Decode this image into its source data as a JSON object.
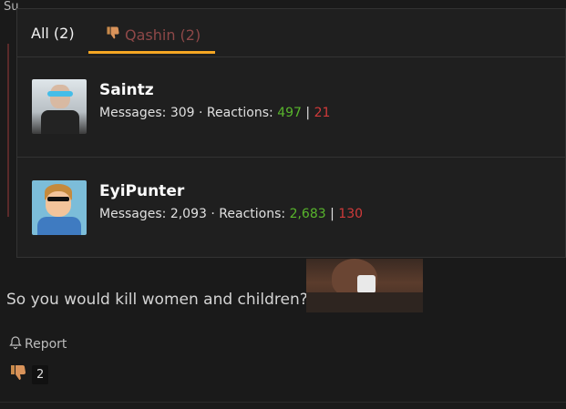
{
  "background_post": {
    "cut_text": "Su",
    "text": "So you would kill women and children?",
    "report_label": "Report",
    "reaction_count": "2"
  },
  "popup": {
    "tabs": {
      "all_label": "All (2)",
      "qashin_label": "Qashin (2)"
    },
    "users": [
      {
        "name": "Saintz",
        "messages_label": "Messages:",
        "messages": "309",
        "reactions_label": "Reactions:",
        "reactions_positive": "497",
        "reactions_negative": "21"
      },
      {
        "name": "EyiPunter",
        "messages_label": "Messages:",
        "messages": "2,093",
        "reactions_label": "Reactions:",
        "reactions_positive": "2,683",
        "reactions_negative": "130"
      }
    ]
  },
  "colors": {
    "accent_underline": "#f5a623",
    "positive": "#58b52c",
    "negative": "#d03a3a",
    "qashin_tab": "#8e4848"
  },
  "icons": [
    "thumbs-down-icon",
    "bell-icon"
  ]
}
